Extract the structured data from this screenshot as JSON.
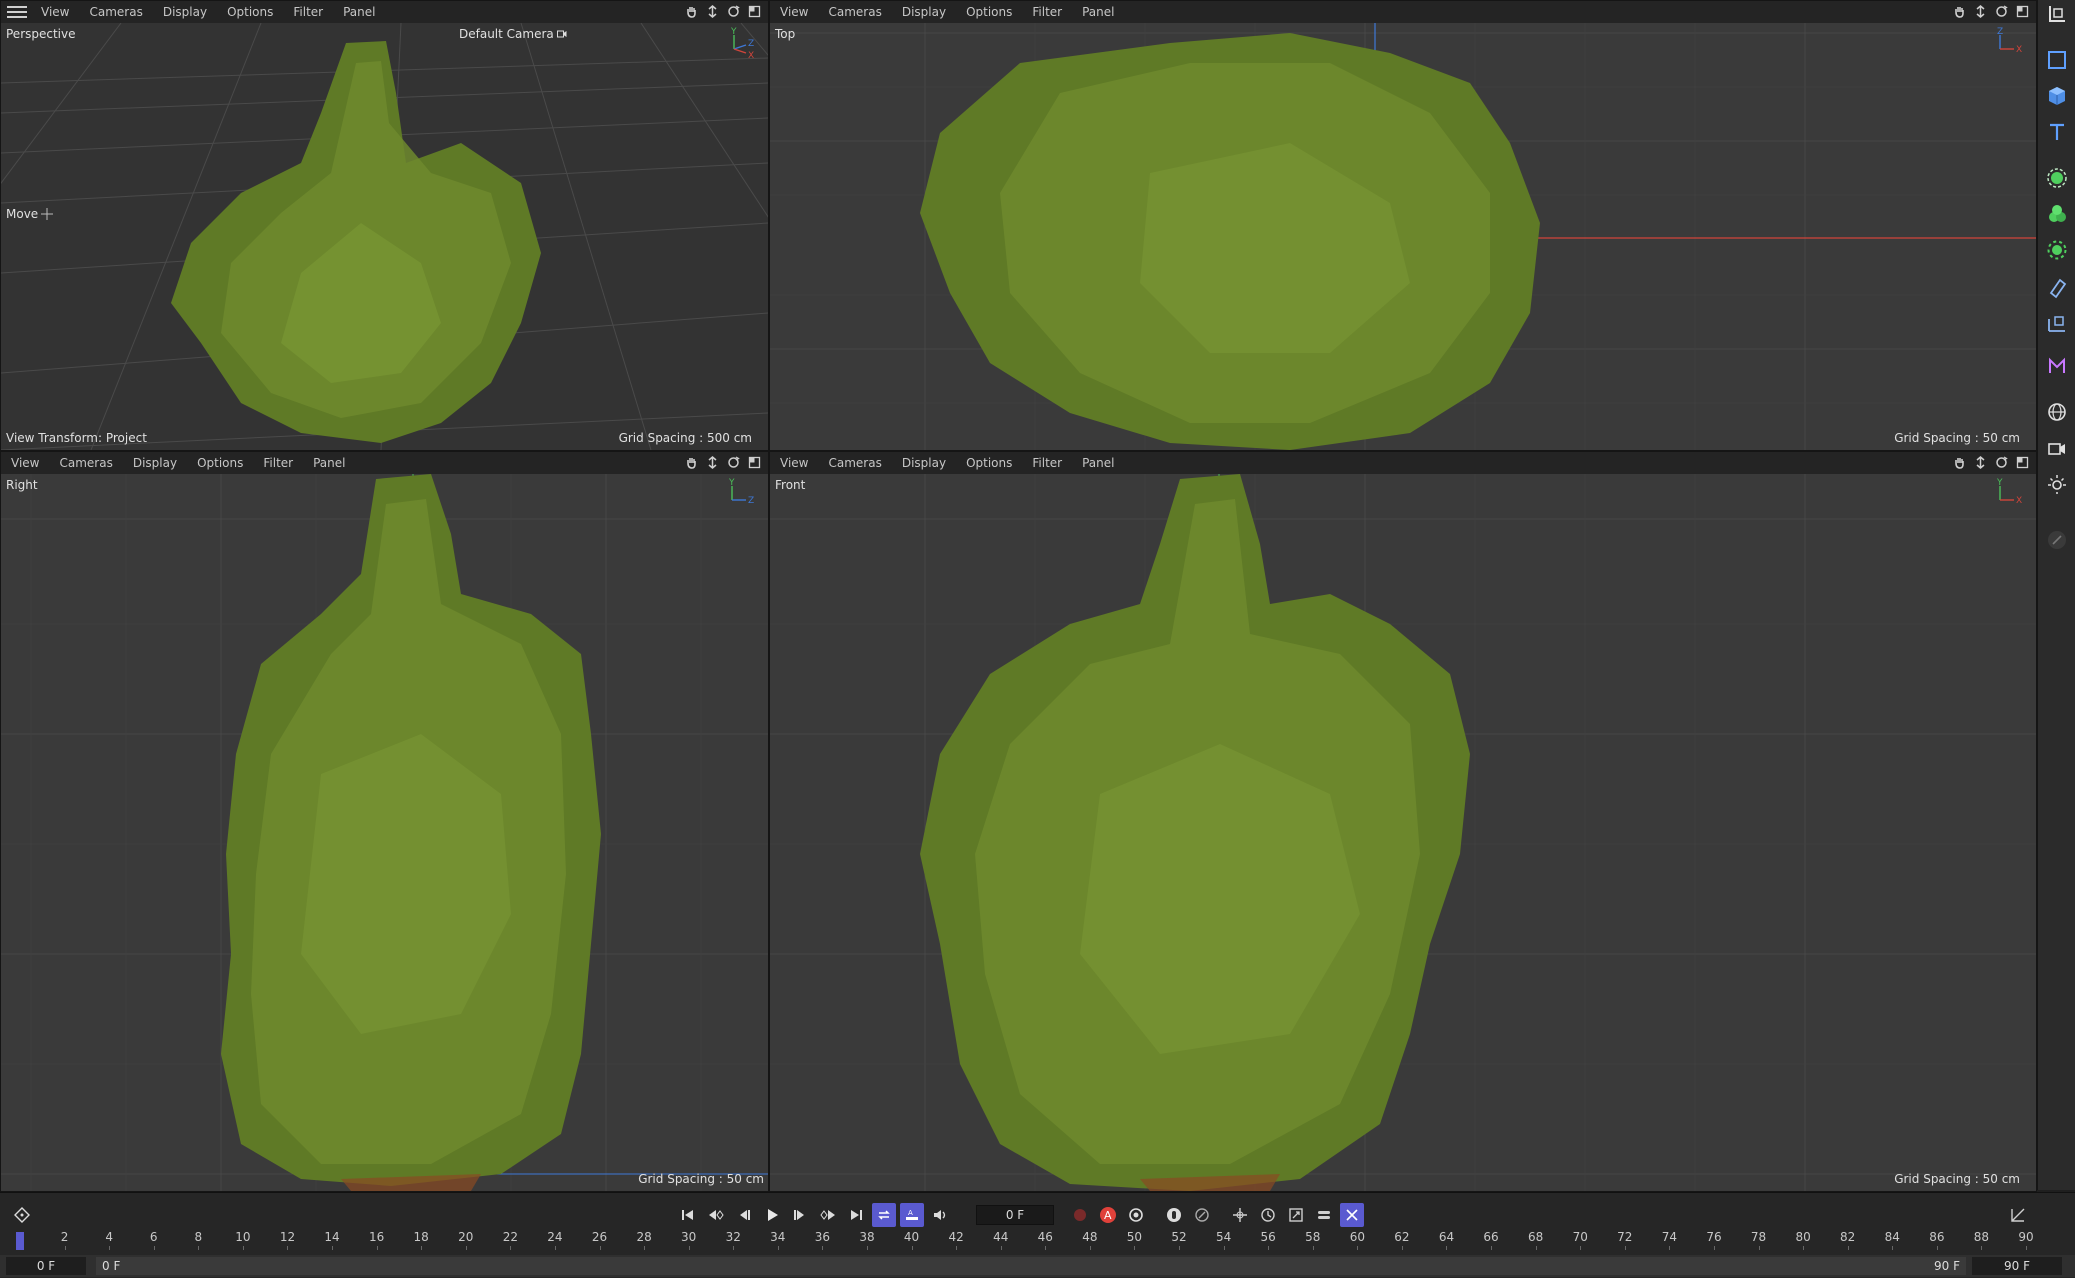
{
  "menu": [
    "View",
    "Cameras",
    "Display",
    "Options",
    "Filter",
    "Panel"
  ],
  "viewports": {
    "perspective": {
      "label": "Perspective",
      "camera": "Default Camera",
      "tool": "Move",
      "footer_left": "View Transform: Project",
      "footer_right": "Grid Spacing : 500 cm",
      "axes": {
        "y": "Y",
        "z": "Z",
        "x": "X"
      }
    },
    "top": {
      "label": "Top",
      "footer_right": "Grid Spacing : 50 cm",
      "axes": {
        "z": "Z",
        "x": "X"
      }
    },
    "right": {
      "label": "Right",
      "footer_right": "Grid Spacing : 50 cm",
      "axes": {
        "y": "Y",
        "z": "Z"
      }
    },
    "front": {
      "label": "Front",
      "footer_right": "Grid Spacing : 50 cm",
      "axes": {
        "y": "Y",
        "x": "X"
      }
    }
  },
  "right_toolbar": [
    "coordinate-icon",
    "square-icon",
    "cube-icon",
    "text-icon",
    "sphere-gear-icon",
    "particles-icon",
    "generator-icon",
    "deformer-icon",
    "scene-icon",
    "mograph-icon",
    "globe-icon",
    "camera-icon",
    "light-icon",
    "pen-icon"
  ],
  "timeline": {
    "current_frame": "0 F",
    "ruler_labels": [
      "0",
      "2",
      "4",
      "6",
      "8",
      "10",
      "12",
      "14",
      "16",
      "18",
      "20",
      "22",
      "24",
      "26",
      "28",
      "30",
      "32",
      "34",
      "36",
      "38",
      "40",
      "42",
      "44",
      "46",
      "48",
      "50",
      "52",
      "54",
      "56",
      "58",
      "60",
      "62",
      "64",
      "66",
      "68",
      "70",
      "72",
      "74",
      "76",
      "78",
      "80",
      "82",
      "84",
      "86",
      "88",
      "90"
    ],
    "start_field": "0 F",
    "min_field": "0 F",
    "max_field": "90 F",
    "end_field": "90 F"
  },
  "colors": {
    "viewport_bg": "#3a3a3a",
    "foliage": "#6f8a2e",
    "axis_x": "#d0453b",
    "axis_y": "#4bbf5a",
    "axis_z": "#3e78d6",
    "accent": "#5a5ad0"
  }
}
